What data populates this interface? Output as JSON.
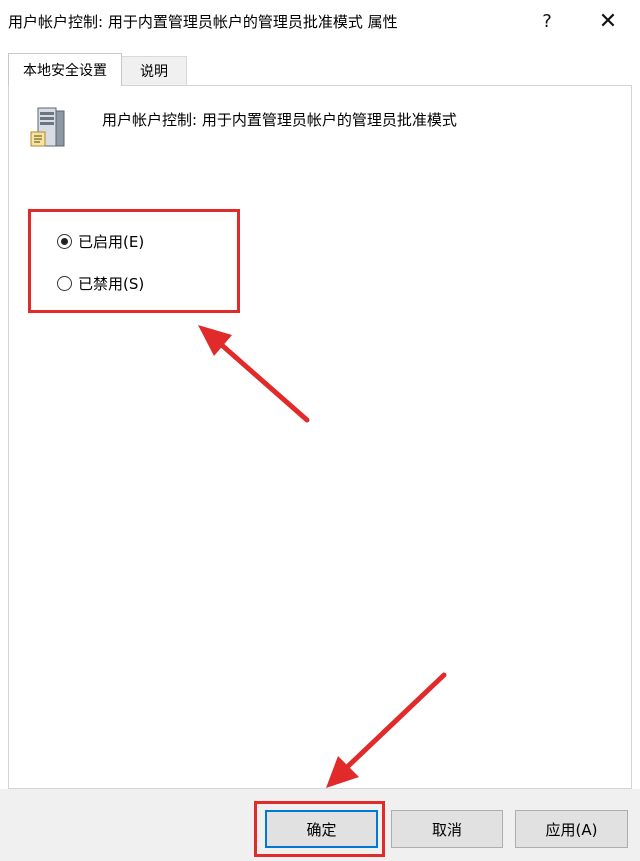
{
  "window": {
    "title": "用户帐户控制: 用于内置管理员帐户的管理员批准模式 属性",
    "help_glyph": "?",
    "close_glyph": "✕"
  },
  "tabs": [
    {
      "label": "本地安全设置",
      "active": true
    },
    {
      "label": "说明",
      "active": false
    }
  ],
  "policy": {
    "icon": "server-policy-icon",
    "name": "用户帐户控制: 用于内置管理员帐户的管理员批准模式"
  },
  "options": [
    {
      "label": "已启用(E)",
      "selected": true
    },
    {
      "label": "已禁用(S)",
      "selected": false
    }
  ],
  "buttons": {
    "ok": "确定",
    "cancel": "取消",
    "apply": "应用(A)"
  },
  "annotations": {
    "color": "#e12a2a"
  }
}
